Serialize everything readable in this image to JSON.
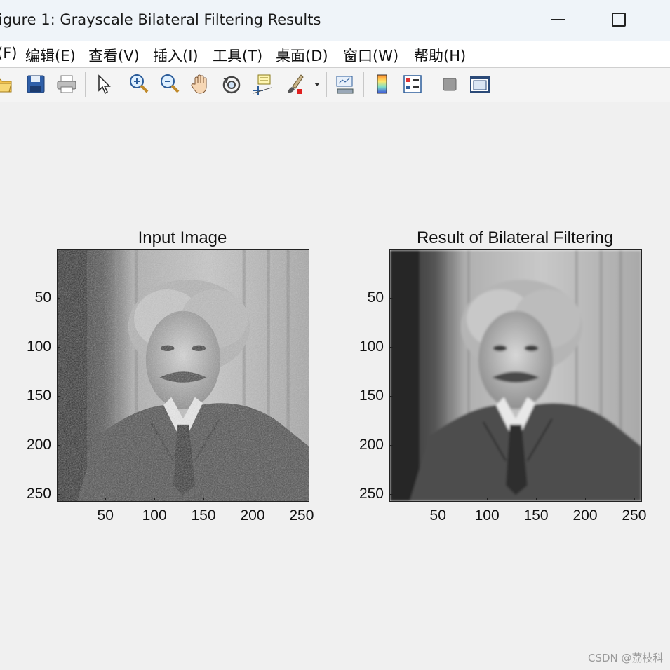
{
  "window": {
    "title": "igure 1: Grayscale Bilateral Filtering Results"
  },
  "menu": [
    "(F)",
    "编辑(E)",
    "查看(V)",
    "插入(I)",
    "工具(T)",
    "桌面(D)",
    "窗口(W)",
    "帮助(H)"
  ],
  "toolbar_icons": [
    "open-icon",
    "save-icon",
    "print-icon",
    "pointer-icon",
    "zoom-in-icon",
    "zoom-out-icon",
    "pan-hand-icon",
    "rotate-3d-icon",
    "data-cursor-icon",
    "brush-icon",
    "brush-dropdown-icon",
    "link-plot-icon",
    "colorbar-icon",
    "legend-icon",
    "hide-plot-tools-icon",
    "show-plot-tools-icon"
  ],
  "axes": [
    {
      "title": "Input Image",
      "xticks": [
        "50",
        "100",
        "150",
        "200",
        "250"
      ],
      "yticks": [
        "50",
        "100",
        "150",
        "200",
        "250"
      ],
      "tick_values": [
        50,
        100,
        150,
        200,
        250
      ],
      "range": [
        0.5,
        256.5
      ],
      "image": "grayscale portrait, noisy"
    },
    {
      "title": "Result of Bilateral Filtering",
      "xticks": [
        "50",
        "100",
        "150",
        "200",
        "250"
      ],
      "yticks": [
        "50",
        "100",
        "150",
        "200",
        "250"
      ],
      "tick_values": [
        50,
        100,
        150,
        200,
        250
      ],
      "range": [
        0.5,
        256.5
      ],
      "image": "grayscale portrait, smoothed"
    }
  ],
  "watermark": "CSDN @荔枝科"
}
